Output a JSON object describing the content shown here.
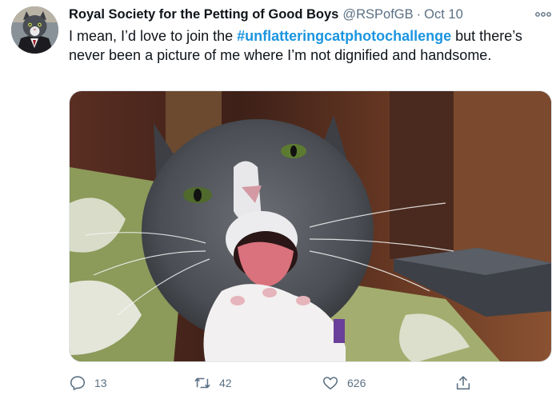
{
  "author": {
    "display_name": "Royal Society for the Petting of Good Boys",
    "handle": "@RSPofGB",
    "separator": "·",
    "date": "Oct 10",
    "avatar_icon": "cat-in-suit-avatar"
  },
  "tweet": {
    "text_before": "I mean, I’d love to join the ",
    "hashtag": "#unflatteringcatphotochallenge",
    "text_after": " but there’s never been a picture of me where I’m not dignified and handsome."
  },
  "media": {
    "kind": "photo",
    "subject": "cat-photo"
  },
  "actions": {
    "reply": {
      "icon": "reply-icon",
      "count": "13"
    },
    "retweet": {
      "icon": "retweet-icon",
      "count": "42"
    },
    "like": {
      "icon": "heart-icon",
      "count": "626"
    },
    "share": {
      "icon": "share-icon"
    }
  },
  "colors": {
    "text_primary": "#0f1419",
    "text_secondary": "#5b7083",
    "hashtag": "#1b95e0"
  }
}
